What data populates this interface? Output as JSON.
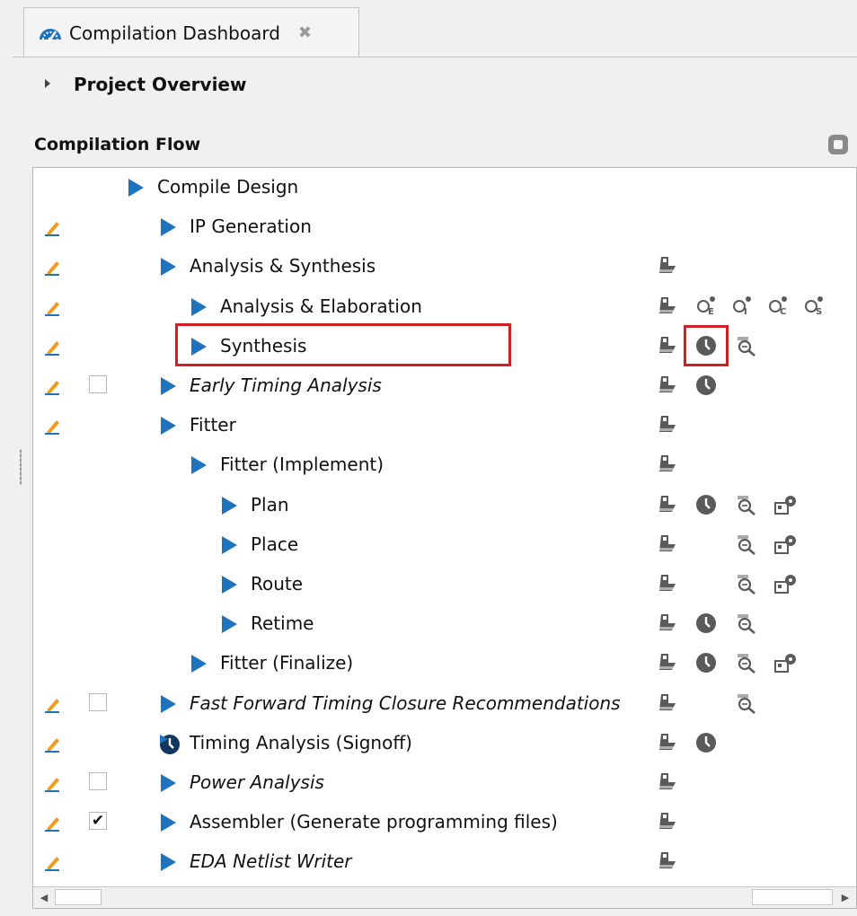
{
  "tab": {
    "label": "Compilation Dashboard",
    "close_glyph": "✖",
    "icon": "dashboard-gauge-icon"
  },
  "overview": {
    "title": "Project Overview",
    "expanded": false
  },
  "flow": {
    "title": "Compilation Flow",
    "rows": [
      {
        "label": "Compile Design",
        "italic": false,
        "edit": false,
        "checkbox": null,
        "arrow": "play",
        "icons": []
      },
      {
        "label": "IP Generation",
        "italic": false,
        "edit": true,
        "checkbox": null,
        "arrow": "play",
        "icons": []
      },
      {
        "label": "Analysis & Synthesis",
        "italic": false,
        "edit": true,
        "checkbox": null,
        "arrow": "play",
        "icons": [
          "report"
        ]
      },
      {
        "label": "Analysis & Elaboration",
        "italic": false,
        "edit": true,
        "checkbox": null,
        "arrow": "play",
        "icons": [
          "report",
          "viewer-e",
          "viewer-i",
          "viewer-c",
          "viewer-s"
        ]
      },
      {
        "label": "Synthesis",
        "italic": false,
        "edit": true,
        "checkbox": null,
        "arrow": "play",
        "icons": [
          "report",
          "timing-clock",
          "chip-planner"
        ],
        "highlighted": true
      },
      {
        "label": "Early Timing Analysis",
        "italic": true,
        "edit": true,
        "checkbox": false,
        "arrow": "play",
        "icons": [
          "report",
          "timing-clock"
        ]
      },
      {
        "label": "Fitter",
        "italic": false,
        "edit": true,
        "checkbox": null,
        "arrow": "play",
        "icons": [
          "report"
        ]
      },
      {
        "label": "Fitter (Implement)",
        "italic": false,
        "edit": false,
        "checkbox": null,
        "arrow": "play",
        "icons": [
          "report"
        ]
      },
      {
        "label": "Plan",
        "italic": false,
        "edit": false,
        "checkbox": null,
        "arrow": "play",
        "icons": [
          "report",
          "timing-clock",
          "chip-planner",
          "interface-planner"
        ]
      },
      {
        "label": "Place",
        "italic": false,
        "edit": false,
        "checkbox": null,
        "arrow": "play",
        "icons": [
          "report",
          null,
          "chip-planner",
          "interface-planner"
        ]
      },
      {
        "label": "Route",
        "italic": false,
        "edit": false,
        "checkbox": null,
        "arrow": "play",
        "icons": [
          "report",
          null,
          "chip-planner",
          "interface-planner"
        ]
      },
      {
        "label": "Retime",
        "italic": false,
        "edit": false,
        "checkbox": null,
        "arrow": "play",
        "icons": [
          "report",
          "timing-clock",
          "chip-planner"
        ]
      },
      {
        "label": "Fitter (Finalize)",
        "italic": false,
        "edit": false,
        "checkbox": null,
        "arrow": "play",
        "icons": [
          "report",
          "timing-clock",
          "chip-planner",
          "interface-planner"
        ]
      },
      {
        "label": "Fast Forward Timing Closure Recommendations",
        "italic": true,
        "edit": true,
        "checkbox": false,
        "arrow": "play",
        "icons": [
          "report",
          null,
          "chip-planner"
        ]
      },
      {
        "label": "Timing Analysis (Signoff)",
        "italic": false,
        "edit": true,
        "checkbox": null,
        "arrow": "timing-play",
        "icons": [
          "report",
          "timing-clock"
        ]
      },
      {
        "label": "Power Analysis",
        "italic": true,
        "edit": true,
        "checkbox": false,
        "arrow": "play",
        "icons": [
          "report"
        ]
      },
      {
        "label": "Assembler (Generate programming files)",
        "italic": false,
        "edit": true,
        "checkbox": true,
        "arrow": "play",
        "icons": [
          "report"
        ]
      },
      {
        "label": "EDA Netlist Writer",
        "italic": true,
        "edit": true,
        "checkbox": null,
        "arrow": "play",
        "icons": [
          "report"
        ]
      }
    ]
  },
  "checkmark_glyph": "✔",
  "scrollbar": {
    "left_glyph": "◀",
    "right_glyph": "▶"
  },
  "colors": {
    "accent_blue": "#1e73be",
    "highlight_red": "#d11f25",
    "icon_gray": "#5a5a5a",
    "edit_orange": "#f29a1f"
  }
}
